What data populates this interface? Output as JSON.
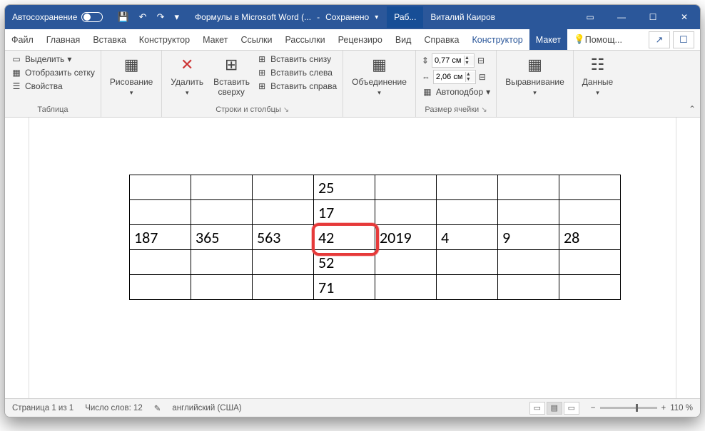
{
  "titlebar": {
    "autosave": "Автосохранение",
    "doc": "Формулы в Microsoft Word (...",
    "saved": "Сохранено",
    "tab": "Раб...",
    "user": "Виталий Каиров"
  },
  "tabs": {
    "file": "Файл",
    "home": "Главная",
    "insert": "Вставка",
    "design": "Конструктор",
    "layout_page": "Макет",
    "references": "Ссылки",
    "mailings": "Рассылки",
    "review": "Рецензиро",
    "view": "Вид",
    "help": "Справка",
    "table_design": "Конструктор",
    "table_layout": "Макет",
    "tell": "Помощ..."
  },
  "ribbon": {
    "table_group": "Таблица",
    "select": "Выделить",
    "gridlines": "Отобразить сетку",
    "properties": "Свойства",
    "draw": "Рисование",
    "delete": "Удалить",
    "insert_above": "Вставить сверху",
    "insert_below": "Вставить снизу",
    "insert_left": "Вставить слева",
    "insert_right": "Вставить справа",
    "rows_cols_group": "Строки и столбцы",
    "merge": "Объединение",
    "height_val": "0,77 см",
    "width_val": "2,06 см",
    "autofit": "Автоподбор",
    "cellsize_group": "Размер ячейки",
    "alignment": "Выравнивание",
    "data": "Данные"
  },
  "table": {
    "rows": [
      [
        "",
        "",
        "",
        "25",
        "",
        "",
        "",
        ""
      ],
      [
        "",
        "",
        "",
        "17",
        "",
        "",
        "",
        ""
      ],
      [
        "187",
        "365",
        "563",
        "42",
        "2019",
        "4",
        "9",
        "28"
      ],
      [
        "",
        "",
        "",
        "52",
        "",
        "",
        "",
        ""
      ],
      [
        "",
        "",
        "",
        "71",
        "",
        "",
        "",
        ""
      ]
    ]
  },
  "status": {
    "page": "Страница 1 из 1",
    "words": "Число слов: 12",
    "lang": "английский (США)",
    "zoom": "110 %"
  }
}
